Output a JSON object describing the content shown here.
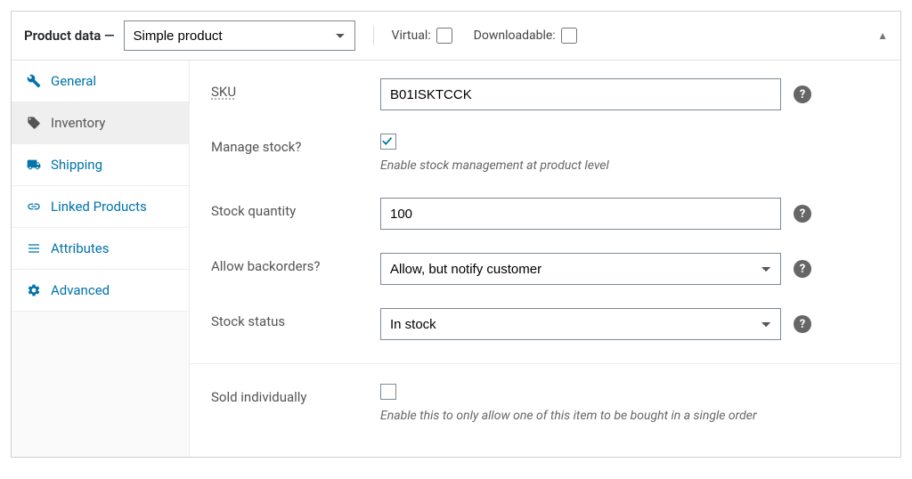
{
  "header": {
    "title": "Product data —",
    "product_type": "Simple product",
    "virtual_label": "Virtual:",
    "downloadable_label": "Downloadable:"
  },
  "tabs": [
    {
      "label": "General",
      "icon": "wrench"
    },
    {
      "label": "Inventory",
      "icon": "tag"
    },
    {
      "label": "Shipping",
      "icon": "truck"
    },
    {
      "label": "Linked Products",
      "icon": "link"
    },
    {
      "label": "Attributes",
      "icon": "list"
    },
    {
      "label": "Advanced",
      "icon": "gear"
    }
  ],
  "fields": {
    "sku": {
      "label": "SKU",
      "value": "B01ISKTCCK"
    },
    "manage_stock": {
      "label": "Manage stock?",
      "checked": true,
      "description": "Enable stock management at product level"
    },
    "stock_quantity": {
      "label": "Stock quantity",
      "value": "100"
    },
    "allow_backorders": {
      "label": "Allow backorders?",
      "value": "Allow, but notify customer"
    },
    "stock_status": {
      "label": "Stock status",
      "value": "In stock"
    },
    "sold_individually": {
      "label": "Sold individually",
      "checked": false,
      "description": "Enable this to only allow one of this item to be bought in a single order"
    }
  }
}
